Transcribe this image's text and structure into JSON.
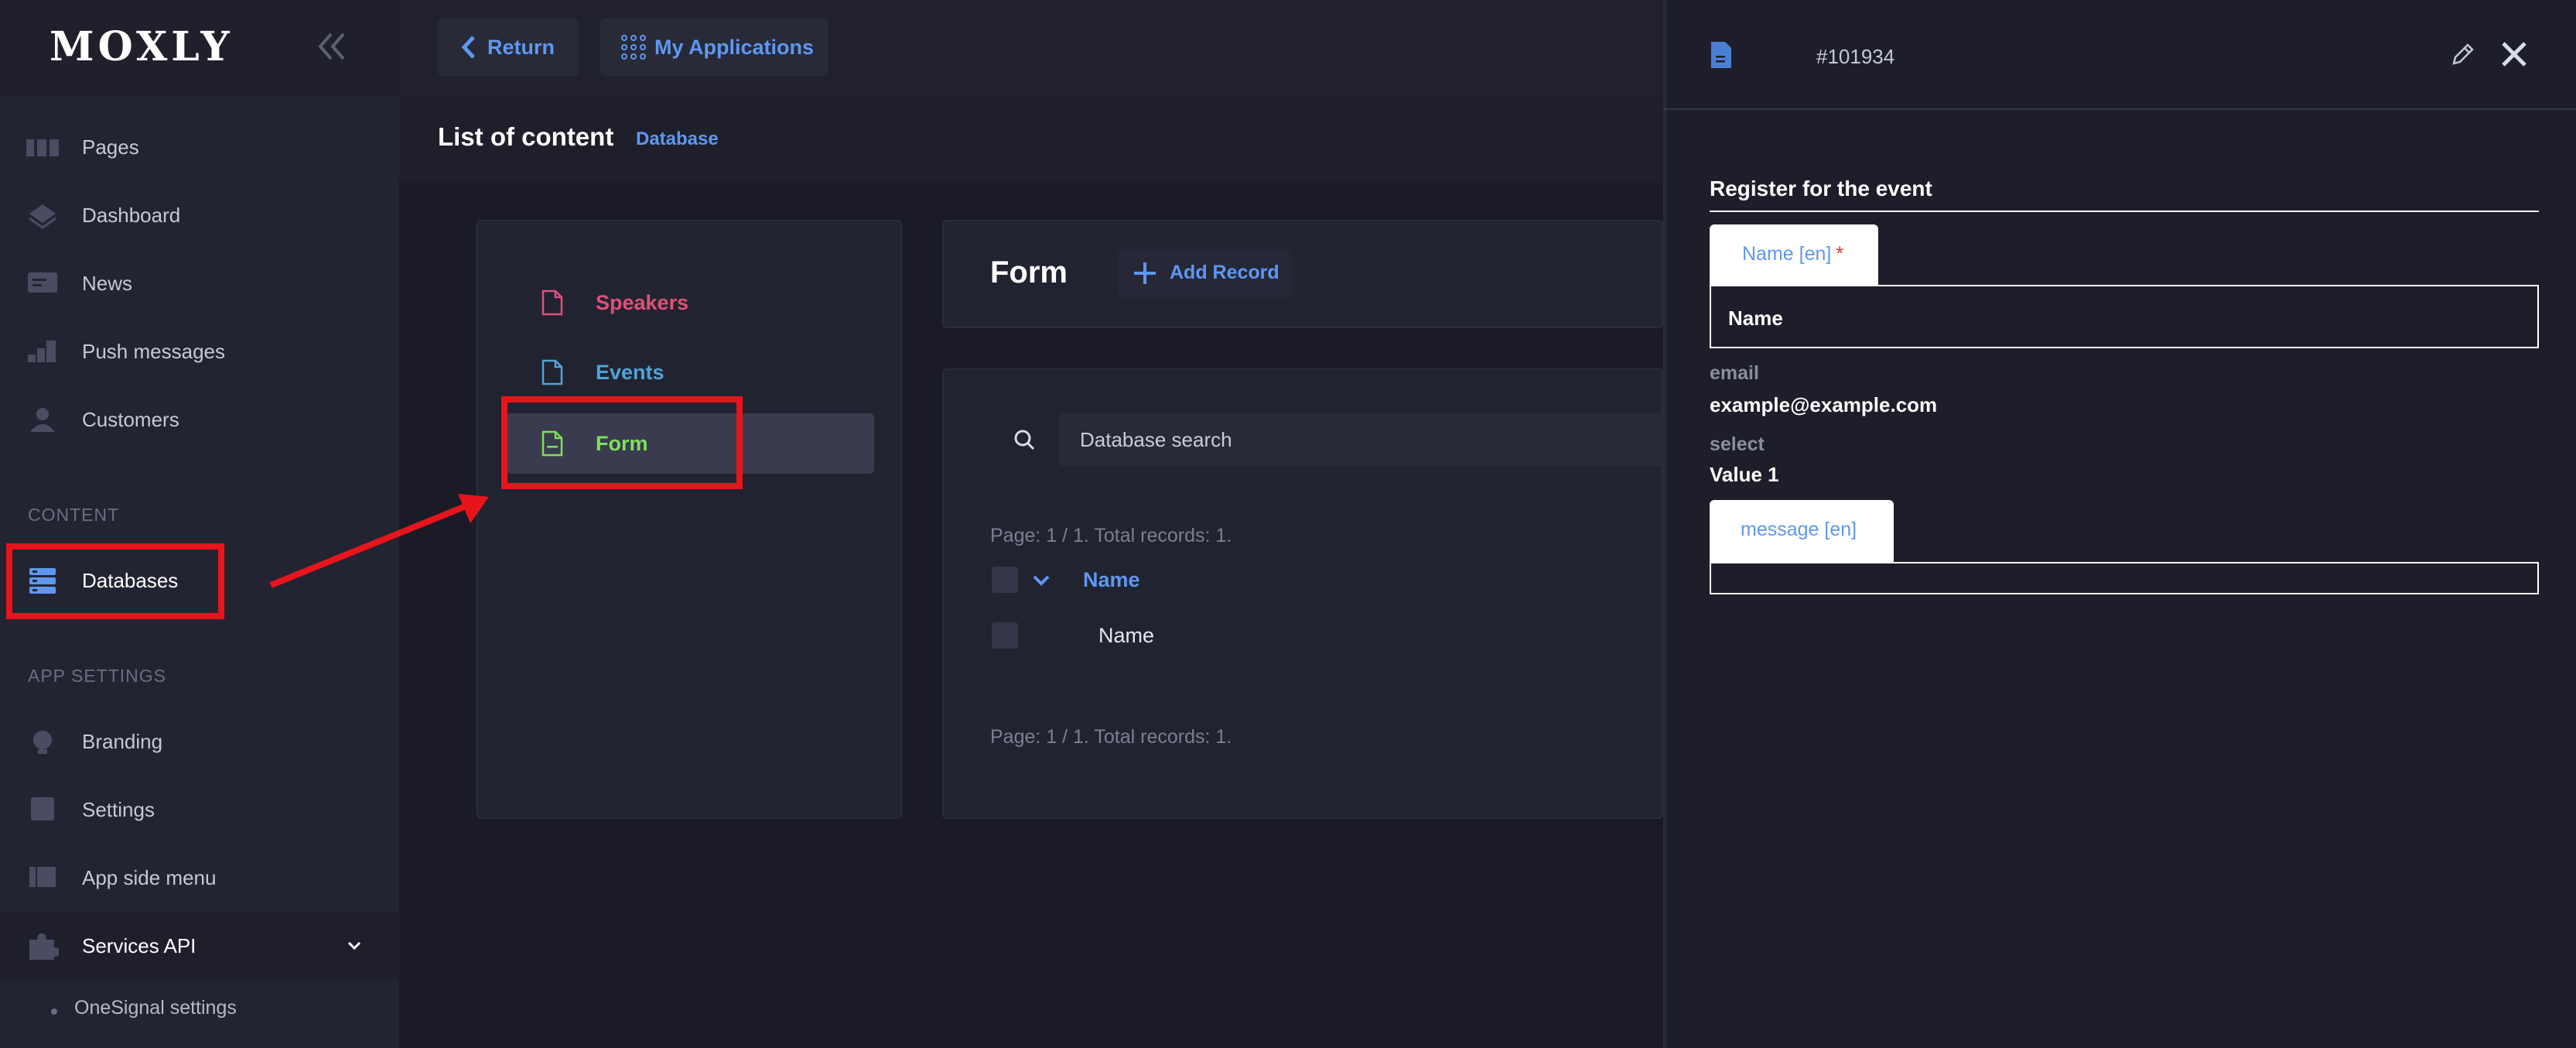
{
  "app": {
    "logo": "MOXLY"
  },
  "sidebar": {
    "items": [
      {
        "label": "Pages",
        "icon": "pages-icon"
      },
      {
        "label": "Dashboard",
        "icon": "dashboard-icon"
      },
      {
        "label": "News",
        "icon": "news-icon"
      },
      {
        "label": "Push messages",
        "icon": "push-icon"
      },
      {
        "label": "Customers",
        "icon": "customers-icon"
      }
    ],
    "content_section": "CONTENT",
    "databases_label": "Databases",
    "app_settings_section": "APP SETTINGS",
    "settings_items": [
      {
        "label": "Branding",
        "icon": "branding-icon"
      },
      {
        "label": "Settings",
        "icon": "settings-icon"
      },
      {
        "label": "App side menu",
        "icon": "side-menu-icon"
      }
    ],
    "services_label": "Services API",
    "services_sub": "OneSignal settings"
  },
  "topbar": {
    "return_label": "Return",
    "apps_label": "My Applications"
  },
  "header": {
    "title": "List of content",
    "crumb": "Database"
  },
  "list": {
    "items": [
      {
        "label": "Speakers",
        "color": "#e0507a"
      },
      {
        "label": "Events",
        "color": "#4fa3d8"
      },
      {
        "label": "Form",
        "color": "#7ee05a"
      }
    ]
  },
  "form": {
    "title": "Form",
    "add_label": "Add Record"
  },
  "table": {
    "search_placeholder": "Database search",
    "pager_top": "Page: 1 / 1. Total records: 1.",
    "pager_bottom": "Page: 1 / 1. Total records: 1.",
    "column": "Name",
    "rows": [
      {
        "name": "Name"
      }
    ]
  },
  "detail": {
    "record_id": "#101934",
    "section_title": "Register for the event",
    "name_tab": "Name [en]",
    "required_mark": "*",
    "name_value": "Name",
    "email_label": "email",
    "email_value": "example@example.com",
    "select_label": "select",
    "select_value": "Value 1",
    "message_tab": "message [en]"
  },
  "colors": {
    "accent": "#5f97f0",
    "highlight": "#e8141c"
  }
}
